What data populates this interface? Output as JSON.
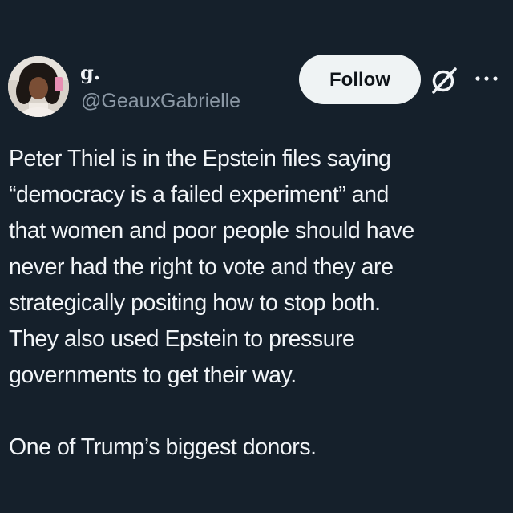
{
  "author": {
    "display_name": "g.",
    "handle": "@GeauxGabrielle",
    "avatar_icon": "profile-photo"
  },
  "actions": {
    "follow_label": "Follow",
    "grok_icon": "grok-icon",
    "more_icon": "more-options-icon"
  },
  "tweet": {
    "paragraphs": [
      "Peter Thiel is in the Epstein files saying\n“democracy is a failed experiment” and\nthat women and poor people should have\nnever had the right to vote and they are\nstrategically positing how to stop both.\nThey also used Epstein to pressure\ngovernments to get their way.",
      "One of Trump’s biggest donors."
    ]
  },
  "colors": {
    "background": "#15202b",
    "text": "#f1f4f7",
    "secondary_text": "#8b98a5",
    "follow_button_bg": "#eff3f4",
    "follow_button_text": "#0f1419"
  }
}
